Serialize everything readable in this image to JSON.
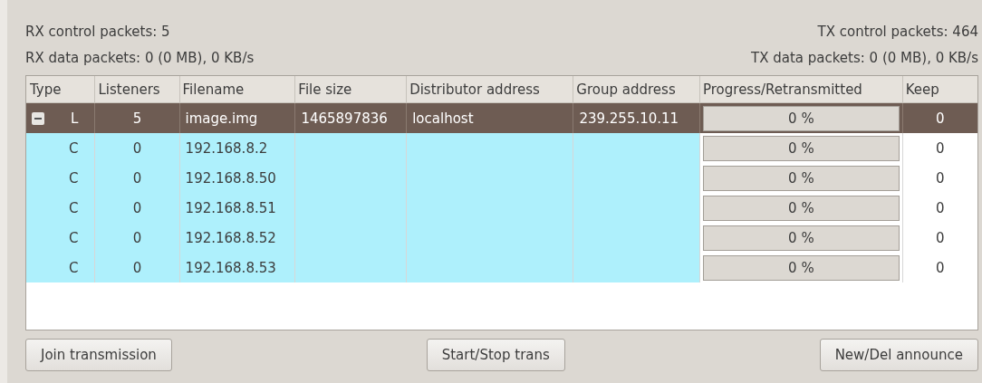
{
  "stats": {
    "rx_control": "RX control packets: 5",
    "tx_control": "TX control packets: 464",
    "rx_data": "RX data packets: 0 (0 MB), 0 KB/s",
    "tx_data": "TX data packets: 0 (0 MB), 0 KB/s"
  },
  "table": {
    "columns": [
      "Type",
      "Listeners",
      "Filename",
      "File size",
      "Distributor address",
      "Group address",
      "Progress/Retransmitted",
      "Keep"
    ],
    "rows": [
      {
        "type": "L",
        "listeners": "5",
        "filename": "image.img",
        "file_size": "1465897836",
        "distributor": "localhost",
        "group": "239.255.10.11",
        "progress": "0 %",
        "level": 0,
        "keep": "0",
        "selected": true,
        "expanded": true,
        "children": [
          {
            "type": "C",
            "listeners": "0",
            "filename": "192.168.8.2",
            "progress": "0 %",
            "level": 0,
            "keep": "0",
            "selected": false
          },
          {
            "type": "C",
            "listeners": "0",
            "filename": "192.168.8.50",
            "progress": "0 %",
            "level": 0,
            "keep": "0",
            "selected": false
          },
          {
            "type": "C",
            "listeners": "0",
            "filename": "192.168.8.51",
            "progress": "0 %",
            "level": 0,
            "keep": "0",
            "selected": false
          },
          {
            "type": "C",
            "listeners": "0",
            "filename": "192.168.8.52",
            "progress": "0 %",
            "level": 0,
            "keep": "0",
            "selected": false
          },
          {
            "type": "C",
            "listeners": "0",
            "filename": "192.168.8.53",
            "progress": "0 %",
            "level": 0,
            "keep": "0",
            "selected": false
          }
        ]
      }
    ]
  },
  "buttons": [
    "Join transmission",
    "Start/Stop trans",
    "New/Del announce"
  ]
}
